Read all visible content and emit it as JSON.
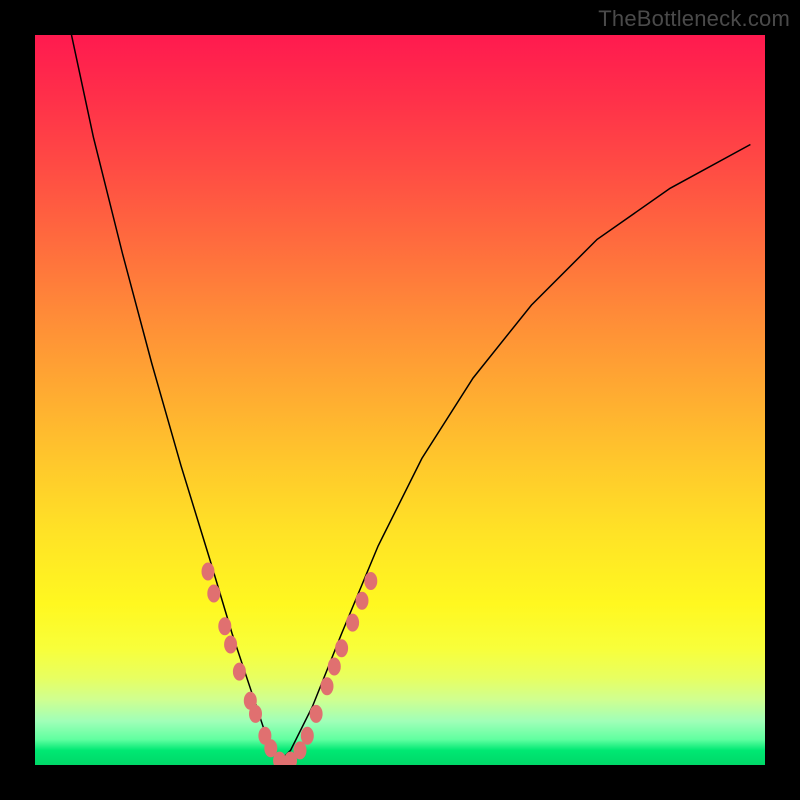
{
  "watermark": "TheBottleneck.com",
  "colors": {
    "gradient_top": "#ff1a4f",
    "gradient_mid": "#ffe226",
    "gradient_bottom": "#00d868",
    "curve": "#000000",
    "bead": "#e07070",
    "frame": "#000000"
  },
  "chart_data": {
    "type": "line",
    "title": "",
    "xlabel": "",
    "ylabel": "",
    "xlim": [
      0,
      1
    ],
    "ylim": [
      0,
      1
    ],
    "notes": "V-shaped bottleneck curve with colored gradient background (red=high bottleneck, green=low). Minimum around x≈0.33. Pink bead markers cluster near the valley on both flanks. No axis ticks visible.",
    "series": [
      {
        "name": "bottleneck-curve",
        "x": [
          0.05,
          0.08,
          0.12,
          0.16,
          0.2,
          0.24,
          0.27,
          0.3,
          0.32,
          0.335,
          0.35,
          0.38,
          0.42,
          0.47,
          0.53,
          0.6,
          0.68,
          0.77,
          0.87,
          0.98
        ],
        "values": [
          1.0,
          0.86,
          0.7,
          0.55,
          0.41,
          0.28,
          0.18,
          0.09,
          0.03,
          0.005,
          0.02,
          0.08,
          0.18,
          0.3,
          0.42,
          0.53,
          0.63,
          0.72,
          0.79,
          0.85
        ]
      }
    ],
    "markers": [
      {
        "x": 0.237,
        "y": 0.265
      },
      {
        "x": 0.245,
        "y": 0.235
      },
      {
        "x": 0.26,
        "y": 0.19
      },
      {
        "x": 0.268,
        "y": 0.165
      },
      {
        "x": 0.28,
        "y": 0.128
      },
      {
        "x": 0.295,
        "y": 0.088
      },
      {
        "x": 0.302,
        "y": 0.07
      },
      {
        "x": 0.315,
        "y": 0.04
      },
      {
        "x": 0.323,
        "y": 0.023
      },
      {
        "x": 0.335,
        "y": 0.006
      },
      {
        "x": 0.35,
        "y": 0.006
      },
      {
        "x": 0.363,
        "y": 0.02
      },
      {
        "x": 0.373,
        "y": 0.04
      },
      {
        "x": 0.385,
        "y": 0.07
      },
      {
        "x": 0.4,
        "y": 0.108
      },
      {
        "x": 0.41,
        "y": 0.135
      },
      {
        "x": 0.42,
        "y": 0.16
      },
      {
        "x": 0.435,
        "y": 0.195
      },
      {
        "x": 0.448,
        "y": 0.225
      },
      {
        "x": 0.46,
        "y": 0.252
      }
    ]
  }
}
